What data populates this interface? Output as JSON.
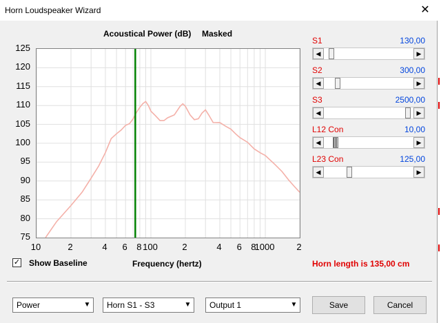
{
  "window": {
    "title": "Horn Loudspeaker Wizard",
    "close_glyph": "✕"
  },
  "graph": {
    "title": "Acoustical Power (dB)",
    "mode": "Masked",
    "x_axis_label": "Frequency (hertz)",
    "y_ticks": [
      "125",
      "120",
      "115",
      "110",
      "105",
      "100",
      "95",
      "90",
      "85",
      "80",
      "75"
    ],
    "x_ticks": [
      "10",
      "2",
      "4",
      "6",
      "8",
      "100",
      "2",
      "4",
      "6",
      "8",
      "1000",
      "2"
    ],
    "curve_color": "#f4b0a8",
    "marker_color": "#008000"
  },
  "chart_data": {
    "type": "line",
    "xscale": "log",
    "xlim": [
      10,
      2000
    ],
    "ylim": [
      75,
      125
    ],
    "marker_x": 73,
    "series": [
      {
        "x": [
          12,
          15,
          20,
          25,
          30,
          35,
          40,
          45,
          50,
          55,
          60,
          65,
          70,
          75,
          80,
          85,
          90,
          95,
          100,
          110,
          120,
          130,
          140,
          160,
          180,
          190,
          200,
          220,
          240,
          260,
          280,
          300,
          320,
          350,
          380,
          400,
          450,
          500,
          550,
          600,
          700,
          800,
          900,
          1000,
          1200,
          1400,
          1600,
          1800,
          2000
        ],
        "y": [
          75,
          79,
          83.5,
          87,
          90.5,
          94,
          97.5,
          101,
          102.5,
          103.5,
          104.5,
          105.2,
          106.5,
          108,
          109.5,
          110.5,
          110.8,
          110,
          108.5,
          107,
          106,
          106,
          106.5,
          107.5,
          109.8,
          110.2,
          109.8,
          107.5,
          106,
          106.5,
          108,
          108.6,
          107.5,
          105.5,
          105.2,
          105.5,
          104.5,
          103.5,
          102.5,
          101.5,
          100,
          98.5,
          97.5,
          96.5,
          94.5,
          92.5,
          90,
          88.5,
          87
        ]
      }
    ]
  },
  "show_baseline": {
    "label": "Show Baseline",
    "checked": true,
    "check_glyph": "✓"
  },
  "horn_length": "Horn length is 135,00 cm",
  "sliders": [
    {
      "name": "S1",
      "value": "130,00",
      "thumb_frac": 0.06,
      "active": false
    },
    {
      "name": "S2",
      "value": "300,00",
      "thumb_frac": 0.13,
      "active": false
    },
    {
      "name": "S3",
      "value": "2500,00",
      "thumb_frac": 0.97,
      "active": false
    },
    {
      "name": "L12  Con",
      "value": "10,00",
      "thumb_frac": 0.11,
      "active": true
    },
    {
      "name": "L23  Con",
      "value": "125,00",
      "thumb_frac": 0.27,
      "active": false
    }
  ],
  "arrows": {
    "left": "◀",
    "right": "▶",
    "down": "▼"
  },
  "combos": [
    {
      "name": "type",
      "value": "Power"
    },
    {
      "name": "section",
      "value": "Horn S1 - S3"
    },
    {
      "name": "output",
      "value": "Output 1"
    }
  ],
  "buttons": {
    "save": "Save",
    "cancel": "Cancel"
  }
}
